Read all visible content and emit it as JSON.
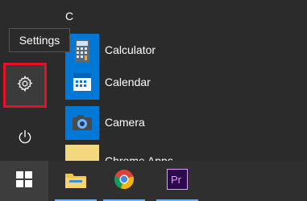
{
  "tooltip": {
    "text": "Settings"
  },
  "rail": {
    "settings_icon": "gear-icon",
    "power_icon": "power-icon",
    "highlight_color": "#e81123"
  },
  "app_list": {
    "section_letter": "C",
    "items": [
      {
        "label": "Calculator",
        "icon": "calculator-icon"
      },
      {
        "label": "Calendar",
        "icon": "calendar-icon"
      },
      {
        "label": "Camera",
        "icon": "camera-icon"
      },
      {
        "label": "Chrome Apps",
        "icon": "folder-icon",
        "expandable": true
      }
    ]
  },
  "taskbar": {
    "items": [
      {
        "name": "start",
        "icon": "windows-logo-icon"
      },
      {
        "name": "file-explorer",
        "icon": "folder-icon"
      },
      {
        "name": "google-chrome",
        "icon": "chrome-icon"
      },
      {
        "name": "premiere-pro",
        "icon": "premiere-icon",
        "label": "Pr"
      }
    ]
  },
  "colors": {
    "tile_blue": "#0078d7",
    "background": "#2b2b2b",
    "taskbar": "#2f2f2f",
    "premiere_purple": "#2a0a4a",
    "premiere_text": "#e49bff"
  }
}
